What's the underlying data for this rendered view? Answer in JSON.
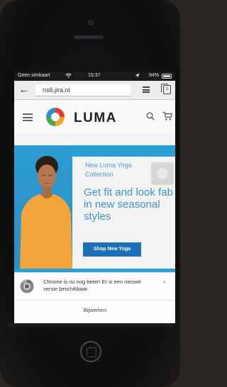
{
  "status_bar": {
    "carrier": "Geen simkaart",
    "time": "15:37",
    "battery": "94%"
  },
  "browser": {
    "url": "ns6.jira.nl",
    "tab_count": "1"
  },
  "store": {
    "brand": "LUMA"
  },
  "hero": {
    "eyebrow": "New Luma Yoga Collection",
    "headline": "Get fit and look fab in new seasonal styles",
    "cta": "Shop New Yoga"
  },
  "chrome_prompt": {
    "message": "Chrome is nu nog beter! Er is een nieuwe versie beschikbaar",
    "update_label": "Bijwerken"
  },
  "colors": {
    "hero_blue": "#29a0d6",
    "cta_blue": "#1e6fb5",
    "headline_blue": "#3f93c9"
  },
  "icons": [
    "back-arrow-icon",
    "menu-icon",
    "tabs-icon",
    "hamburger-icon",
    "luma-logo",
    "search-icon",
    "cart-icon",
    "chrome-icon",
    "wifi-icon",
    "battery-icon",
    "home-button"
  ]
}
